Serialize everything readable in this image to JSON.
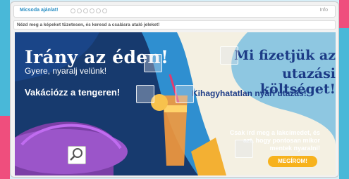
{
  "topbar": {
    "title": "Micsoda ajánlat!",
    "info": "Info",
    "dots": [
      1,
      2,
      3,
      4,
      5,
      6
    ]
  },
  "instruction": "Nézd meg a képeket tüzetesen, és keresd a csalásra utaló jeleket!",
  "ad": {
    "headline": "Irány az éden!",
    "subheadline": "Gyere, nyaralj velünk!",
    "right_headline_1": "Mi fizetjük az",
    "right_headline_2": "utazási költséget!",
    "left_tagline": "Vakációzz a tengeren!",
    "right_tagline": "Kihagyhatatlan nyári utazás!",
    "cta_text": "Csak írd meg a lakcímedet, és azt, hogy pontosan mikor mentek nyaralni!",
    "cta_button": "MEGÍROM!",
    "colors": {
      "navy": "#173a6e",
      "light_blue": "#3aa6e0",
      "cream": "#f4f0e2",
      "purple": "#7b3fa6",
      "yellow": "#f7b21c",
      "headline_blue": "#1c3b86"
    }
  },
  "icons": {
    "magnifier": "magnifier-icon",
    "hotspot": "hotspot-square"
  }
}
